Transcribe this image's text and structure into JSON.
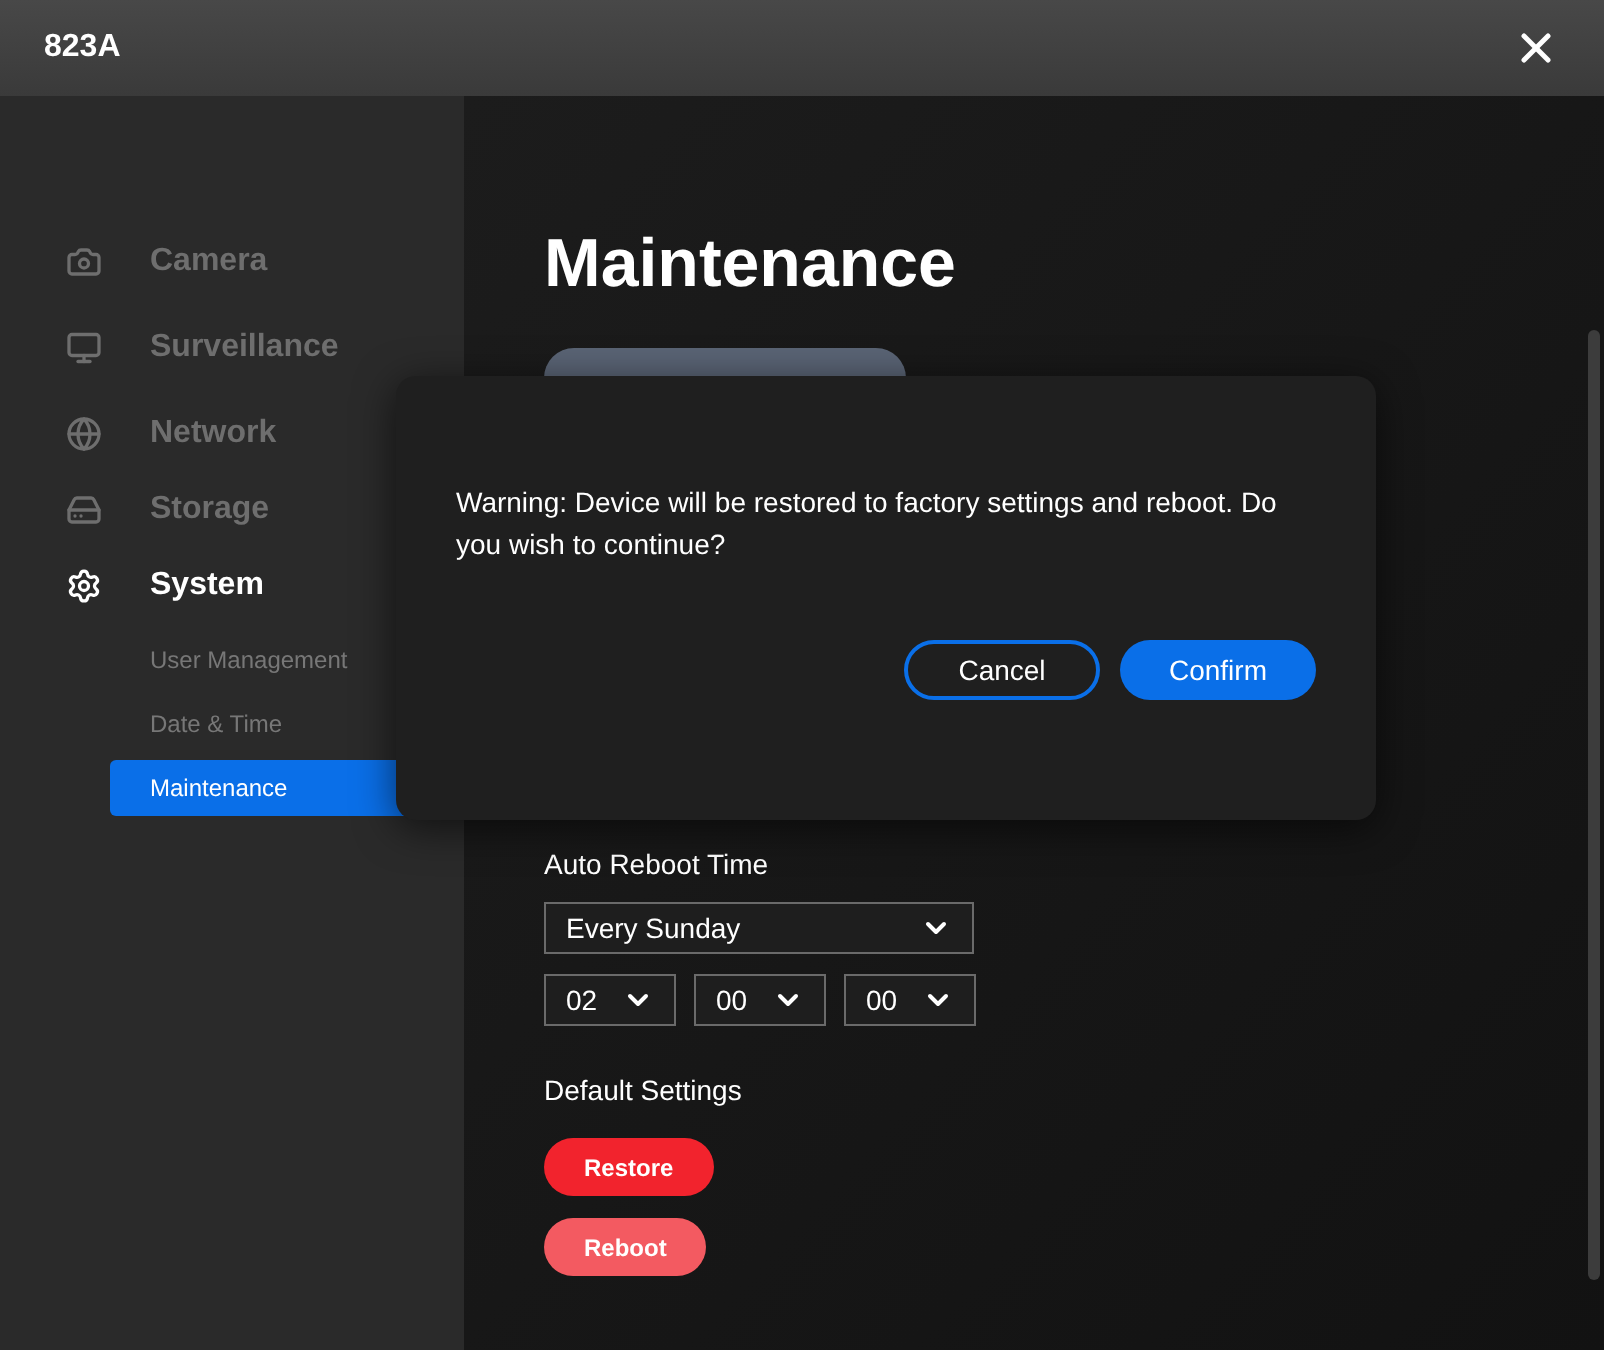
{
  "window": {
    "title": "823A"
  },
  "sidebar": {
    "items": [
      {
        "kind": "camera",
        "label": "Camera",
        "selected": false
      },
      {
        "kind": "monitor",
        "label": "Surveillance",
        "selected": false
      },
      {
        "kind": "globe",
        "label": "Network",
        "selected": false
      },
      {
        "kind": "storage",
        "label": "Storage",
        "selected": false
      },
      {
        "kind": "gear",
        "label": "System",
        "selected": true,
        "children": [
          {
            "label": "User Management",
            "selected": false
          },
          {
            "label": "Date & Time",
            "selected": false
          },
          {
            "label": "Maintenance",
            "selected": true
          }
        ]
      }
    ]
  },
  "page": {
    "title": "Maintenance",
    "auto_reboot": {
      "label": "Auto Reboot Time",
      "day": "Every Sunday",
      "hour": "02",
      "minute": "00",
      "second": "00"
    },
    "default_settings": {
      "label": "Default Settings",
      "buttons": [
        {
          "label": "Restore",
          "kind": "primary"
        },
        {
          "label": "Reboot",
          "kind": "secondary"
        }
      ]
    }
  },
  "dialog": {
    "message": "Warning: Device will be restored to factory settings and reboot. Do you wish to continue?",
    "buttons": [
      {
        "label": "Cancel",
        "kind": "outline"
      },
      {
        "label": "Confirm",
        "kind": "filled"
      }
    ]
  }
}
